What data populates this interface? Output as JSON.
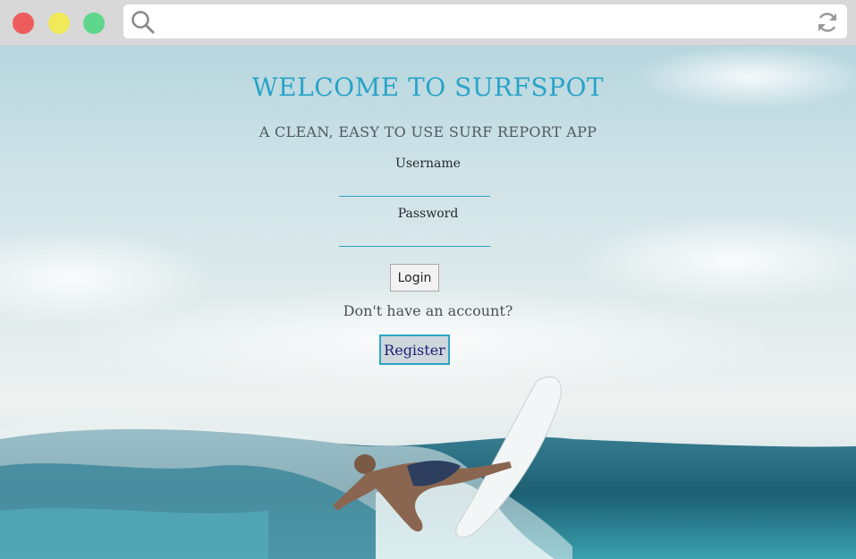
{
  "browser": {
    "controls": [
      "close",
      "minimize",
      "maximize"
    ],
    "address_icons": {
      "left": "search-icon",
      "right": "reload-icon"
    },
    "address_value": ""
  },
  "page": {
    "title": "WELCOME TO SURFSPOT",
    "subtitle": "A CLEAN, EASY TO USE SURF REPORT APP",
    "form": {
      "username_label": "Username",
      "username_value": "",
      "password_label": "Password",
      "password_value": "",
      "login_label": "Login"
    },
    "signup_prompt": "Don't have an account?",
    "register_label": "Register"
  },
  "colors": {
    "accent": "#29a3c8",
    "register_text": "#1b1f72"
  }
}
